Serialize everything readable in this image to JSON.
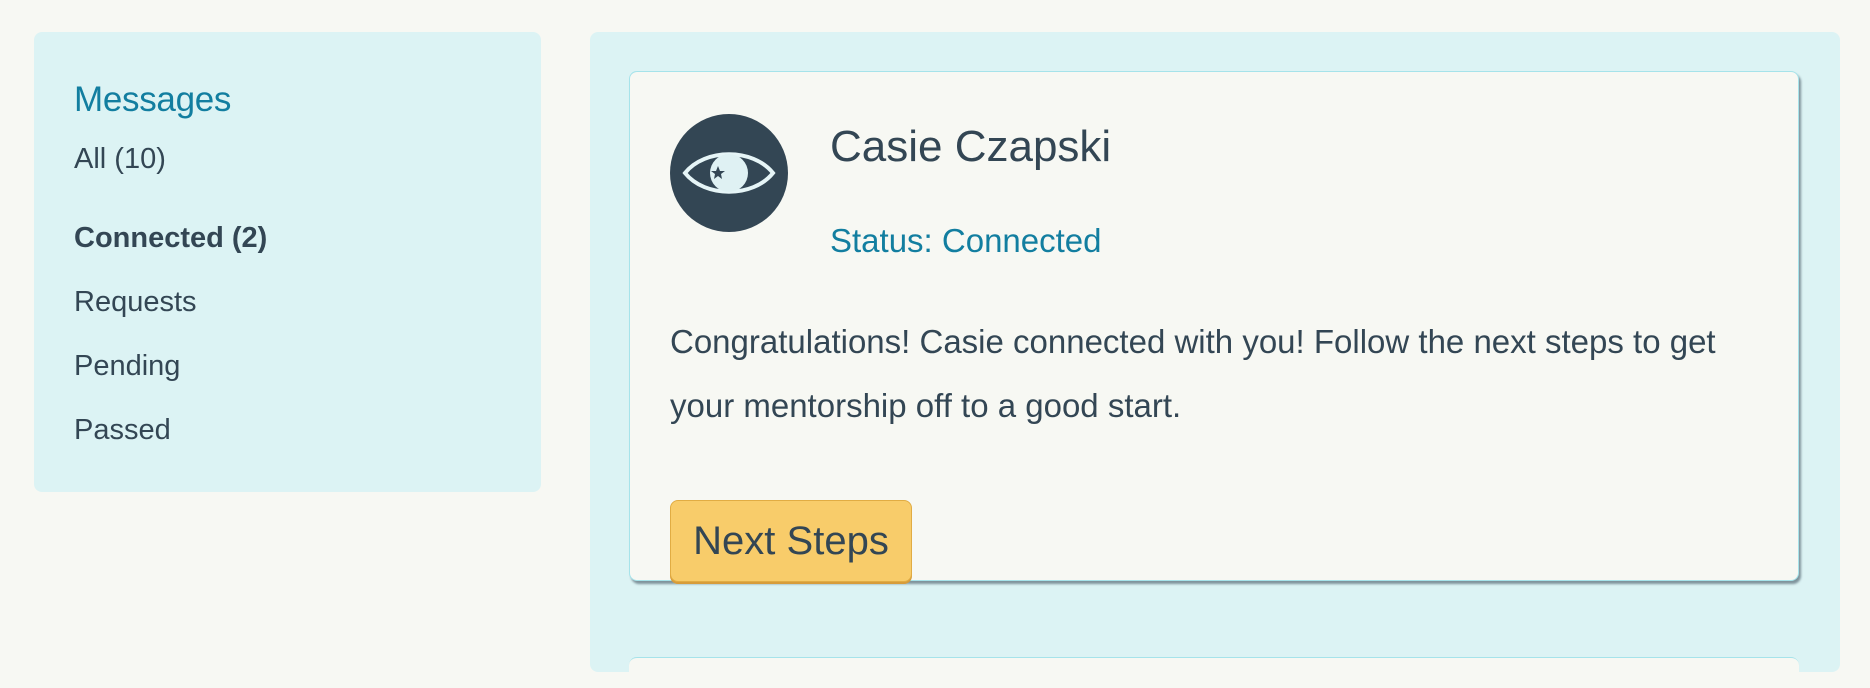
{
  "sidebar": {
    "title": "Messages",
    "items": [
      {
        "label": "All (10)",
        "active": false
      },
      {
        "label": "Connected (2)",
        "active": true
      },
      {
        "label": "Requests",
        "active": false
      },
      {
        "label": "Pending",
        "active": false
      },
      {
        "label": "Passed",
        "active": false
      }
    ]
  },
  "card": {
    "avatar_icon": "eye-icon",
    "name": "Casie Czapski",
    "status": "Status: Connected",
    "message": "Congratulations! Casie connected with you! Follow the next steps to get your mentorship off to a good start.",
    "button_label": "Next Steps"
  },
  "colors": {
    "page_background": "#f7f8f3",
    "panel_background": "#dcf3f4",
    "accent_blue": "#127ea0",
    "text_dark": "#334654",
    "button_yellow": "#f8cc6a"
  }
}
